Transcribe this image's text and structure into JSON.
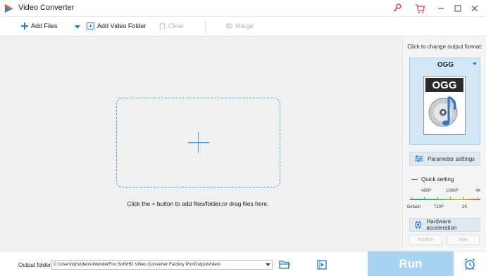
{
  "titlebar": {
    "title": "Video Converter",
    "icons": [
      "app-logo-icon",
      "key-icon",
      "cart-icon",
      "minimize-icon",
      "maximize-icon",
      "close-icon"
    ]
  },
  "toolbar": {
    "add_files": "Add Files",
    "add_video_folder": "Add Video Folder",
    "clear": "Clear",
    "merge": "Merge"
  },
  "main": {
    "hint": "Click the + button to add files/folder,or drag files here."
  },
  "right_panel": {
    "title": "Click to change output format:",
    "format": "OGG",
    "format_icon_text": "OGG",
    "parameter_settings": "Parameter settings",
    "quick_setting": "Quick setting",
    "quality_labels_top": [
      "480P",
      "1080P",
      "4K"
    ],
    "quality_labels_bottom": [
      "Default",
      "720P",
      "2K"
    ],
    "hardware_acceleration": "Hardware acceleration",
    "hw_options": [
      "NVIDIA",
      "Intel"
    ]
  },
  "bottom": {
    "output_folder_label": "Output folder:",
    "output_folder_value": "C:\\Users\\lp\\Videos\\WonderFox Soft\\HD Video Converter Factory Pro\\OutputVideo\\",
    "run": "Run"
  },
  "colors": {
    "accent": "#1f7ed0",
    "dropzone_border": "#4aa2e0",
    "run_button": "#a9d3f2",
    "format_box": "#d3e8f6"
  }
}
